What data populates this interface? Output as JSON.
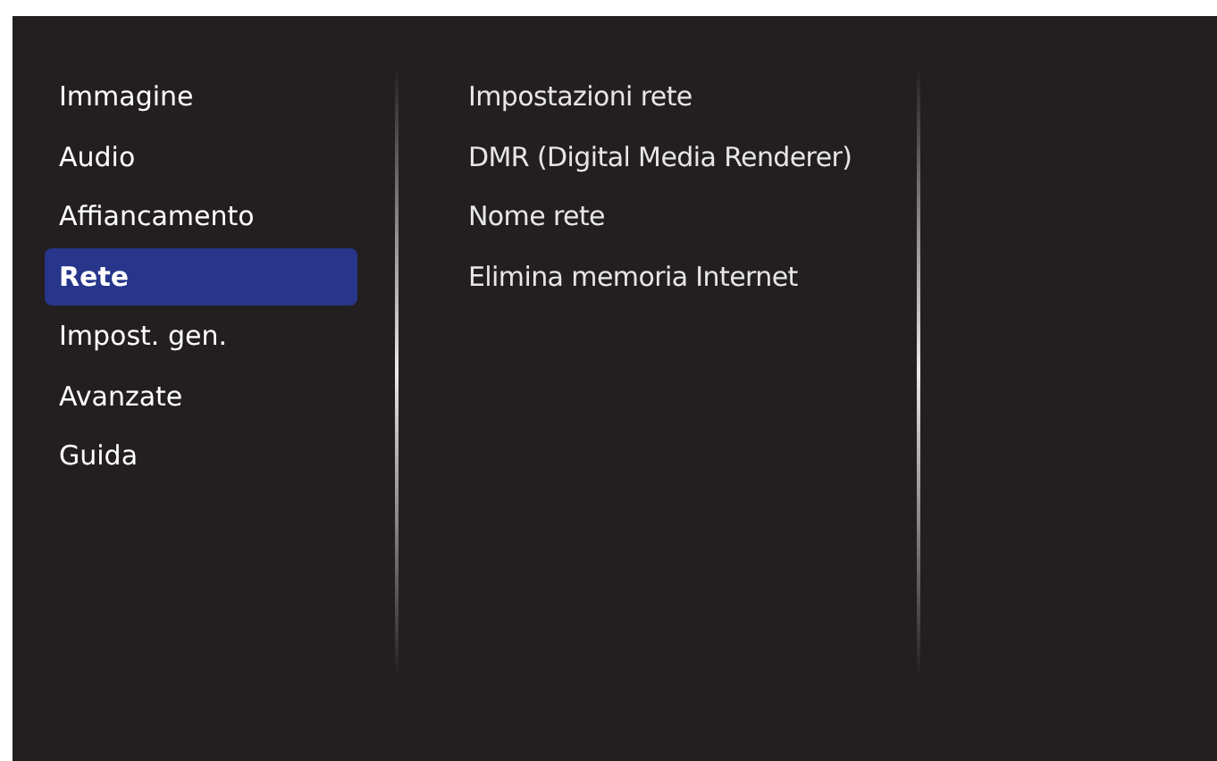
{
  "menu": {
    "items": [
      {
        "label": "Immagine",
        "selected": false
      },
      {
        "label": "Audio",
        "selected": false
      },
      {
        "label": "Affiancamento",
        "selected": false
      },
      {
        "label": "Rete",
        "selected": true
      },
      {
        "label": "Impost. gen.",
        "selected": false
      },
      {
        "label": "Avanzate",
        "selected": false
      },
      {
        "label": "Guida",
        "selected": false
      }
    ]
  },
  "submenu": {
    "items": [
      {
        "label": "Impostazioni rete"
      },
      {
        "label": "DMR (Digital Media Renderer)"
      },
      {
        "label": "Nome rete"
      },
      {
        "label": "Elimina memoria Internet"
      }
    ]
  }
}
